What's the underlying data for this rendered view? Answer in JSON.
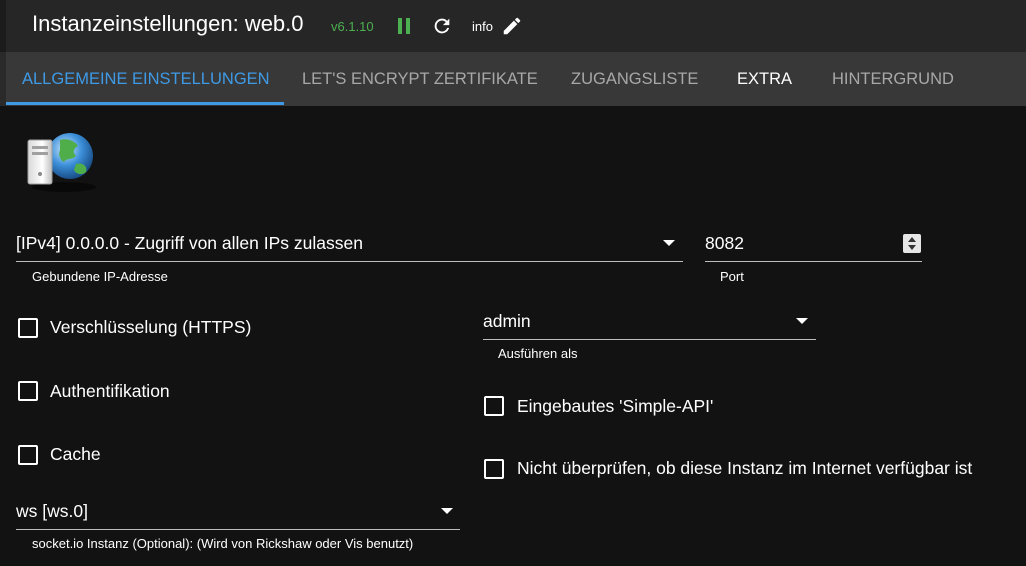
{
  "header": {
    "title": "Instanzeinstellungen: web.0",
    "version": "v6.1.10",
    "info_label": "info",
    "icons": [
      "pause-icon",
      "reload-icon",
      "edit-icon"
    ],
    "version_color": "#4caf50"
  },
  "tabs": [
    {
      "label": "ALLGEMEINE EINSTELLUNGEN",
      "active": true
    },
    {
      "label": "LET'S ENCRYPT ZERTIFIKATE",
      "active": false
    },
    {
      "label": "ZUGANGSLISTE",
      "active": false
    },
    {
      "label": "EXTRA",
      "active": false
    },
    {
      "label": "HINTERGRUND",
      "active": false
    }
  ],
  "accent_color": "#3f9ae6",
  "form": {
    "bind_ip": {
      "value": "[IPv4] 0.0.0.0 - Zugriff von allen IPs zulassen",
      "helper": "Gebundene IP-Adresse"
    },
    "port": {
      "value": "8082",
      "helper": "Port"
    },
    "run_as": {
      "value": "admin",
      "helper": "Ausführen als"
    },
    "https": {
      "label": "Verschlüsselung (HTTPS)",
      "checked": false
    },
    "auth": {
      "label": "Authentifikation",
      "checked": false
    },
    "cache": {
      "label": "Cache",
      "checked": false
    },
    "simple_api": {
      "label": "Eingebautes 'Simple-API'",
      "checked": false
    },
    "no_check": {
      "label": "Nicht überprüfen, ob diese Instanz im Internet verfügbar ist",
      "checked": false
    },
    "socketio": {
      "value": "ws [ws.0]",
      "helper": "socket.io Instanz (Optional): (Wird von Rickshaw oder Vis benutzt)"
    }
  }
}
